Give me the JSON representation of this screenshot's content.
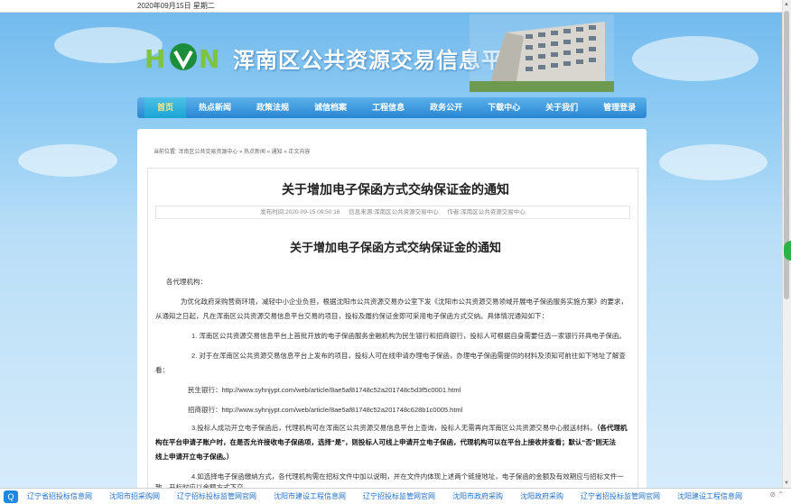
{
  "topbar": {
    "date": "2020年09月15日 星期二"
  },
  "header": {
    "site_title": "浑南区公共资源交易信息平台"
  },
  "nav": {
    "items": [
      "首页",
      "热点新闻",
      "政策法规",
      "诚信档案",
      "工程信息",
      "政务公开",
      "下载中心",
      "关于我们",
      "管理登录"
    ]
  },
  "breadcrumb": "当前位置: 浑南区公共交易资源中心 » 热点新闻 » 通知 » 正文内容",
  "article": {
    "title": "关于增加电子保函方式交纳保证金的通知",
    "meta_time": "发布时间:2020-09-15 09:50:16",
    "meta_source": "信息来源:浑南区公共资源交易中心",
    "meta_author": "作者:浑南区公共资源交易中心",
    "inner_title": "关于增加电子保函方式交纳保证金的通知",
    "greeting": "各代理机构：",
    "p1a": "为优化政府采购营商环境，减轻中小企业负担，根据沈阳市公共资源交易办公室下发《沈阳市公共资源交易领域开展电子保函服务实施方案》的要求，",
    "p1b": "从通知之日起，凡在浑南区公共资源交易信息平台交易的项目，投标及履约保证金即可采用电子保函方式交纳。具体情况通知如下：",
    "item1": "1. 浑南区公共资源交易信息平台上首批开放的电子保函服务金融机构为民生银行和招商银行，投标人可根据自身需要任选一家银行开具电子保函。",
    "item2a": "2. 对于在浑南区公共资源交易信息平台上发布的项目，投标人可在线申请办理电子保函，办理电子保函需提供的材料及须知可前往如下地址了解查",
    "item2b": "看：",
    "link1": "民生银行：http://www.syhnjypt.com/web/article/8ae5af81748c52a201748c5d3f5c0001.html",
    "link2": "招商银行：http://www.syhnjypt.com/web/article/8ae5af81748c52a201748c628b1c0005.html",
    "item3a": "3.投标人成功开立电子保函后，代理机构可在浑南区公共资源交易信息平台上查询，投标人无需再向浑南区公共资源交易中心报送材料。",
    "item3a_bold": "（各代理机",
    "item3b": "构在平台申请子账户时，在是否允许接收电子保函项，选择“是”，则投标人可线上申请开立电子保函，代理机构可以在平台上接收并查看；默认“否”则无法",
    "item3c": "线上申请开立电子保函。）",
    "item4a": "4.如选择电子保函缴纳方式，各代理机构需在招标文件中加以说明，并在文件内体现上述两个链接地址，电子保函的金额及有效期应与招标文件一",
    "item4b": "致，开标时应以金额方式下交"
  },
  "bottom_links": [
    "辽宁省招投标信息网",
    "沈阳市招采购网",
    "辽宁招标投标监管网官网",
    "沈阳市建设工程信息网",
    "辽宁招投标监管网官网",
    "沈阳市政府采购",
    "沈阳政府采购",
    "辽宁省招投标监管网官网",
    "沈阳建设工程信息网"
  ],
  "colors": {
    "nav": "#2a86d3",
    "link": "#1e6fc8",
    "accent": "#ffe97a"
  }
}
